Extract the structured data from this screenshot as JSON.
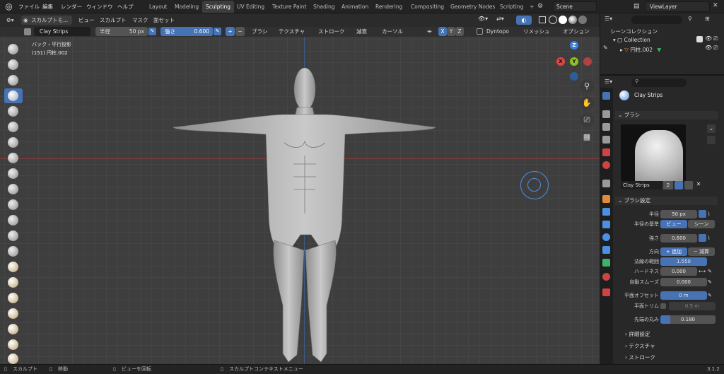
{
  "menus": [
    "ファイル",
    "編集",
    "レンダー",
    "ウィンドウ",
    "ヘルプ"
  ],
  "workspaces": [
    "Layout",
    "Modeling",
    "Sculpting",
    "UV Editing",
    "Texture Paint",
    "Shading",
    "Animation",
    "Rendering",
    "Compositing",
    "Geometry Nodes",
    "Scripting"
  ],
  "active_workspace": "Sculpting",
  "add_tab": "+",
  "scene": "Scene",
  "view_layer": "ViewLayer",
  "viewport_header": {
    "mode": "スカルプトモ...",
    "menus": [
      "ビュー",
      "スカルプト",
      "マスク",
      "面セット"
    ]
  },
  "tool_header": {
    "brush_name": "Clay Strips",
    "radius_label": "半径",
    "radius_value": "50 px",
    "strength_label": "強さ",
    "strength_value": "0.600",
    "plus": "+",
    "minus": "−",
    "dropdowns": [
      "ブラシ",
      "テクスチャ",
      "ストローク",
      "減衰",
      "カーソル"
    ],
    "axes": [
      "X",
      "Y",
      "Z"
    ],
    "dyntopo": "Dyntopo",
    "remesh": "リメッシュ",
    "options": "オプション"
  },
  "overlay_text": {
    "view": "バック・平行投影",
    "object": "(151) 円柱.002"
  },
  "gizmo": {
    "x": "X",
    "y": "Y",
    "z": "Z",
    "neg": "−"
  },
  "outliner": {
    "scene_collection": "シーンコレクション",
    "collection": "Collection",
    "object": "円柱.002"
  },
  "properties": {
    "search_placeholder": "",
    "brush_title": "Clay Strips",
    "brush_panel": "ブラシ",
    "brush_name": "Clay Strips",
    "brush_users": "2",
    "settings_panel": "ブラシ設定",
    "radius_label": "半径",
    "radius_value": "50 px",
    "radius_unit_label": "半径の基準",
    "radius_unit_view": "ビュー",
    "radius_unit_scene": "シーン",
    "strength_label": "強さ",
    "strength_value": "0.600",
    "direction_label": "方向",
    "direction_add": "+ 追加",
    "direction_sub": "− 減算",
    "normal_radius_label": "法線の範囲",
    "normal_radius_value": "1.550",
    "hardness_label": "ハードネス",
    "hardness_value": "0.000",
    "autosmooth_label": "自動スムーズ",
    "autosmooth_value": "0.000",
    "plane_offset_label": "平面オフセット",
    "plane_offset_value": "0 m",
    "plane_trim_label": "平面トリム",
    "plane_trim_value": "0.5 m",
    "tip_roundness_label": "先端の丸み",
    "tip_roundness_value": "0.180",
    "advanced": "詳細設定",
    "texture": "テクスチャ",
    "stroke": "ストローク",
    "normal_radius_frac": 1.0,
    "tip_roundness_frac": 0.18
  },
  "statusbar": {
    "item1": "スカルプト",
    "item2": "移動",
    "item3": "ビューを回転",
    "item4": "スカルプトコンテキストメニュー",
    "version": "3.1.2"
  },
  "colors": {
    "accent": "#4772b3",
    "x_axis": "#e14545",
    "y_axis": "#8fc21e",
    "z_axis": "#3b82e0"
  }
}
